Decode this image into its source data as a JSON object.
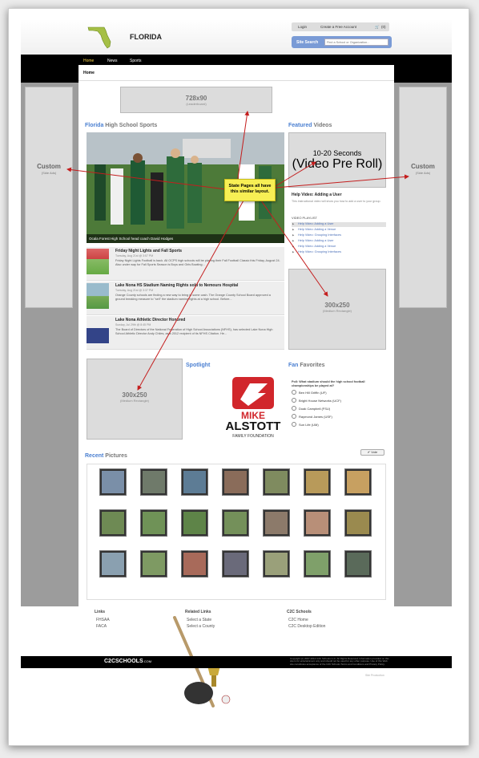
{
  "header": {
    "state_name": "FLORIDA",
    "login": "Login",
    "create_account": "Create a Free Account",
    "cart_count": "(0)",
    "site_search_label": "Site Search",
    "search_placeholder": "Find a School or Organization..."
  },
  "nav": {
    "items": [
      "Home",
      "News",
      "Sports"
    ],
    "active": "Home"
  },
  "breadcrumb": "Home",
  "ads": {
    "leaderboard_size": "728x90",
    "leaderboard_label": "(Leaderboard)",
    "side_title": "Custom",
    "side_label": "(Side Ads)",
    "preroll_title": "10-20 Seconds",
    "preroll_label": "(Video Pre Roll)",
    "rect_size": "300x250",
    "rect_label": "(Medium Rectangle)"
  },
  "sections": {
    "hs_sports_blue": "Florida",
    "hs_sports_rest": " High School Sports",
    "featured_blue": "Featured",
    "featured_rest": " Videos",
    "spotlight": "Spotlight",
    "fan_blue": "Fan",
    "fan_rest": " Favorites",
    "recent_blue": "Recent",
    "recent_rest": " Pictures"
  },
  "hero_caption": "Ocala Forest High School head coach David Hodges",
  "news": [
    {
      "title": "Friday Night Lights and Fall Sports",
      "date": "Tuesday, Aug 21st @ 3:57 PM",
      "body": "Friday Night Lights Football is back. All OCPS high schools will be playing their Fall Football Classic this Friday, August 24. Also under way for Fall Sports Season is Boys and Girls Bowling..."
    },
    {
      "title": "Lake Nona HS Stadium Naming Rights sold to Nemours Hospital",
      "date": "Tuesday, Aug 21st @ 3:37 PM",
      "body": "Orange County schools are finding a new way to bring in some cash. The Orange County School Board approved a ground breaking measure to \"sell\" the stadium naming rights at a high school. Before..."
    },
    {
      "title": "Lake Nona Athletic Director Honored",
      "date": "Sunday, Jul 29th @ 8:45 PM",
      "body": "The Board of Directors of the National Federation of High School Associations (NFHS), has selected Lake Nona High School Athletic Director Andy Chiles, as a 2012 recipient of its NFHS Citation. He..."
    }
  ],
  "video": {
    "help_title": "Help Video: Adding a User",
    "help_desc": "This instructional video will show you how to add a user to your group.",
    "playlist_head": "VIDEO PLAYLIST",
    "playlist": [
      "Help Video: Adding a User",
      "Help Video: Adding a Venue",
      "Help Video: Grouping Interfaces",
      "Help Video: Adding a User",
      "Help Video: Adding a Venue",
      "Help Video: Grouping Interfaces"
    ]
  },
  "spotlight_logo": {
    "line1": "MIKE",
    "line2": "ALSTOTT",
    "line3": "FAMILY FOUNDATION"
  },
  "poll": {
    "question": "Poll: What stadium should the high school football championships be played at?",
    "options": [
      "Ben Hill Griffin (UF)",
      "Bright House Networks (UCF)",
      "Doak Campbell (FSU)",
      "Raymond James (USF)",
      "Sun Life (UM)"
    ],
    "vote_label": "Vote"
  },
  "callout": "State Pages all have this similar layout.",
  "footer": {
    "links_head": "Links",
    "links": [
      "FHSAA",
      "FACA"
    ],
    "related_head": "Related Links",
    "related": [
      "Select a State",
      "Select a County"
    ],
    "c2c_head": "C2C Schools",
    "c2c": [
      "C2C Home",
      "C2C Desktop Edition"
    ],
    "brand": "C2CSCHOOLS",
    "brand_sub": ".COM",
    "copyright": "Copyright (c) 2007-2012 C2C Schools LLC. All Rights Reserved. Information provided on this site is for entertainment only and should not be used for any other purpose. Use of this Web site constitutes acceptance of the C2C Schools Terms and Conditions and Privacy Policy.",
    "site_by": "Site Production"
  },
  "colors": {
    "accent_blue": "#4a7fd1",
    "nav_active": "#ffd84a",
    "callout": "#f7ef54",
    "arrow": "#c41e1e"
  }
}
